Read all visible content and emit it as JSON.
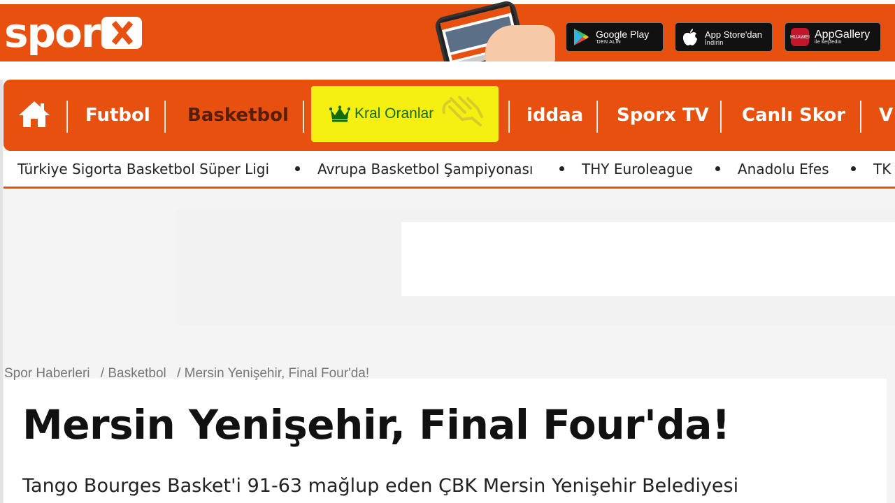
{
  "header": {
    "logo_text": "spor",
    "brand_color": "#e8500f",
    "stores": [
      {
        "name": "google-play",
        "line1": "Google Play",
        "line2": "'DEN ALIN"
      },
      {
        "name": "app-store",
        "line1": "App Store'dan",
        "line2": "İndirin"
      },
      {
        "name": "app-gallery",
        "line1": "AppGallery",
        "line2": "ile keşfedin",
        "icon_text": "HUAWEI"
      }
    ]
  },
  "nav": {
    "items": [
      "Futbol",
      "Basketbol",
      "Kral Oranlar",
      "iddaa",
      "Sporx TV",
      "Canlı Skor",
      "V"
    ],
    "active": "Basketbol",
    "highlight_color": "#f5ef12"
  },
  "subnav": {
    "items": [
      "Türkiye Sigorta Basketbol Süper Ligi",
      "Avrupa Basketbol Şampiyonası",
      "THY Euroleague",
      "Anadolu Efes",
      "TK"
    ]
  },
  "breadcrumb": [
    "Spor Haberleri",
    "/ Basketbol",
    "/ Mersin Yenişehir, Final Four'da!"
  ],
  "article": {
    "title": "Mersin Yenişehir, Final Four'da!",
    "lead": "Tango Bourges Basket'i 91-63 mağlup eden ÇBK Mersin Yenişehir Belediyesi"
  }
}
